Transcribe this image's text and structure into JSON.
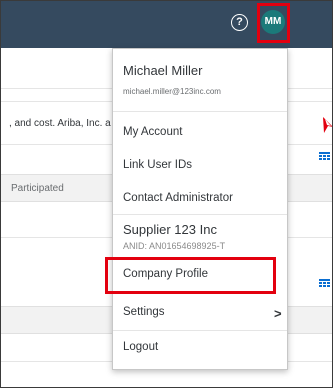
{
  "header": {
    "help_icon": "question-circle-icon",
    "help_glyph": "?",
    "avatar_initials": "MM",
    "bg_color": "#354a5f",
    "avatar_color": "#1b7a7a"
  },
  "background": {
    "banner_text": ", and cost. Ariba, Inc. a",
    "column_header": "Participated"
  },
  "menu": {
    "user_name": "Michael Miller",
    "user_email": "michael.miller@123inc.com",
    "items": [
      {
        "label": "My Account"
      },
      {
        "label": "Link User IDs"
      },
      {
        "label": "Contact Administrator"
      }
    ],
    "company_name": "Supplier 123 Inc",
    "company_anid": "ANID: AN01654698925-T",
    "company_profile": "Company Profile",
    "settings": "Settings",
    "settings_chevron": ">",
    "logout": "Logout"
  },
  "highlight_color": "#e3000f"
}
